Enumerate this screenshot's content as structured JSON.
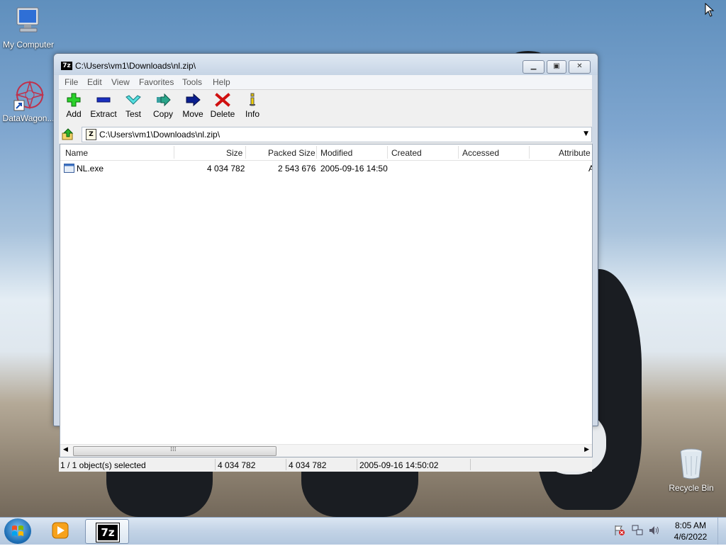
{
  "desktop": {
    "icons": [
      {
        "label": "My Computer"
      },
      {
        "label": "DataWagon..."
      },
      {
        "label": "Recycle Bin"
      }
    ]
  },
  "window": {
    "title": "C:\\Users\\vm1\\Downloads\\nl.zip\\",
    "title_icon_text": "7z",
    "menu": [
      "File",
      "Edit",
      "View",
      "Favorites",
      "Tools",
      "Help"
    ],
    "toolbar": [
      {
        "label": "Add",
        "icon": "add-icon",
        "color": "#2bb52b"
      },
      {
        "label": "Extract",
        "icon": "extract-icon",
        "color": "#1a2fbf"
      },
      {
        "label": "Test",
        "icon": "test-icon",
        "color": "#3cc9c9"
      },
      {
        "label": "Copy",
        "icon": "copy-icon",
        "color": "#2aa58a"
      },
      {
        "label": "Move",
        "icon": "move-icon",
        "color": "#0b1f8f"
      },
      {
        "label": "Delete",
        "icon": "delete-icon",
        "color": "#d01010"
      },
      {
        "label": "Info",
        "icon": "info-icon",
        "color": "#e0c000"
      }
    ],
    "address": {
      "icon_text": "Z",
      "path": "C:\\Users\\vm1\\Downloads\\nl.zip\\"
    },
    "columns": [
      "Name",
      "Size",
      "Packed Size",
      "Modified",
      "Created",
      "Accessed",
      "Attribute"
    ],
    "rows": [
      {
        "name": "NL.exe",
        "size": "4 034 782",
        "packed_size": "2 543 676",
        "modified": "2005-09-16 14:50",
        "created": "",
        "accessed": "",
        "attribute": "A"
      }
    ],
    "scroll_grip": "⁞⁞⁞",
    "status": {
      "selection": "1 / 1 object(s) selected",
      "size": "4 034 782",
      "packed": "4 034 782",
      "modified": "2005-09-16 14:50:02"
    }
  },
  "taskbar": {
    "pinned": [
      {
        "name": "start-button"
      },
      {
        "name": "media-player",
        "icon": "media-player-icon"
      },
      {
        "name": "7zip",
        "text": "7z"
      }
    ],
    "clock": {
      "time": "8:05 AM",
      "date": "4/6/2022"
    }
  }
}
